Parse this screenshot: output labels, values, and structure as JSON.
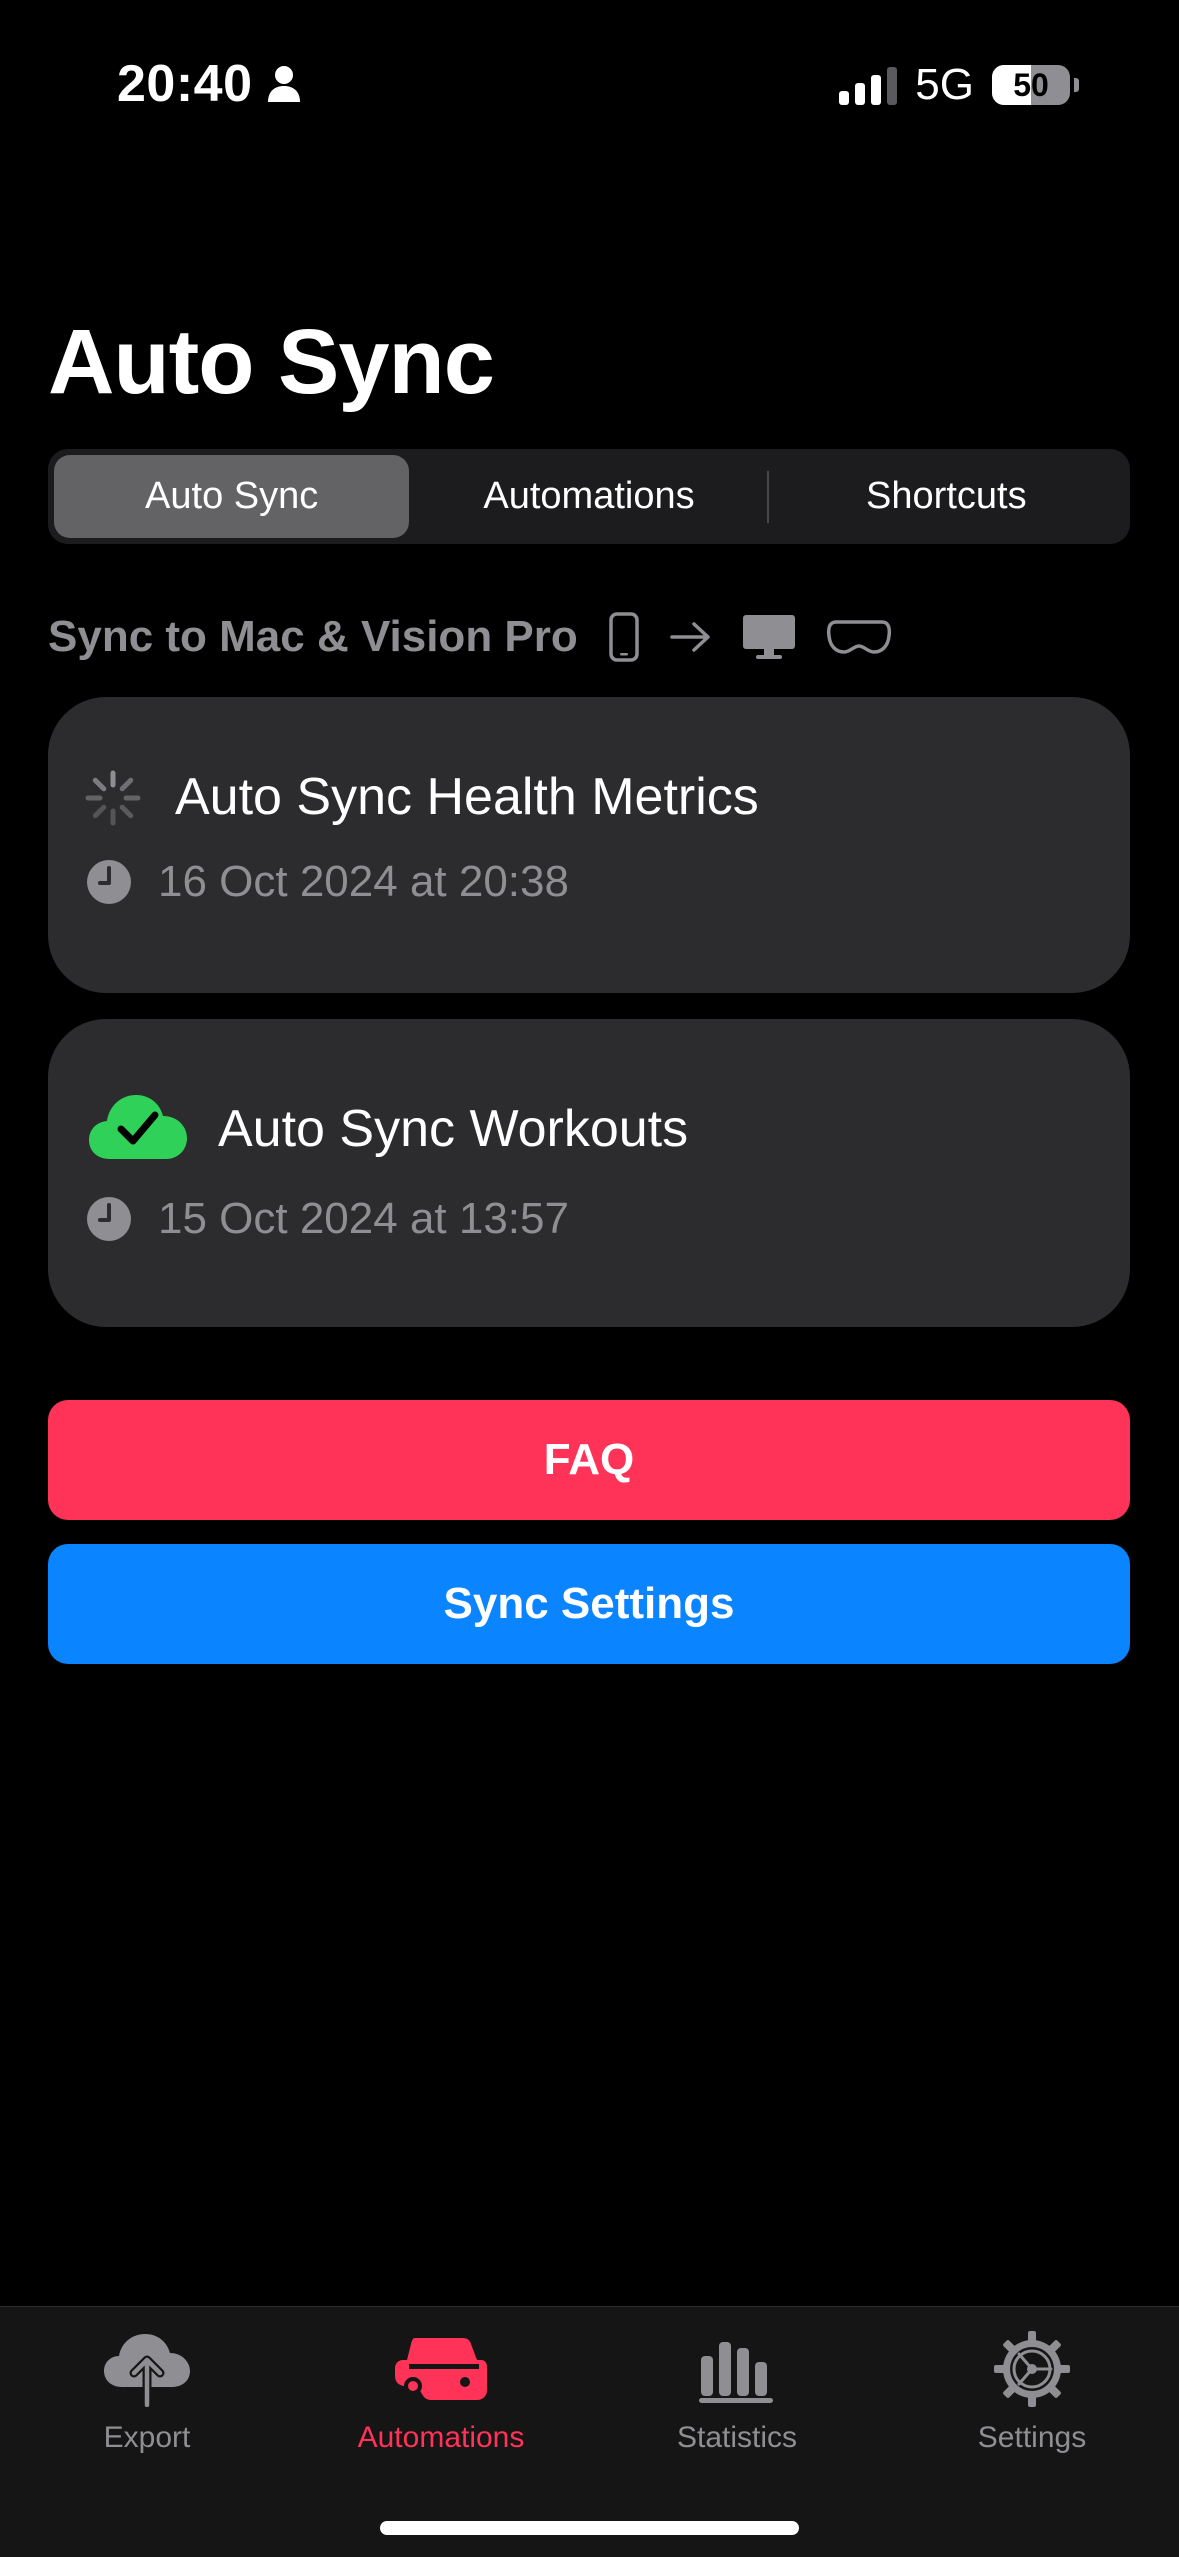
{
  "status_bar": {
    "time": "20:40",
    "network": "5G",
    "battery_level": "50",
    "battery_fraction": 0.5,
    "signal_bars_active": 3,
    "signal_bars_total": 4
  },
  "title": "Auto Sync",
  "segmented": {
    "items": [
      {
        "label": "Auto Sync",
        "active": true
      },
      {
        "label": "Automations",
        "active": false
      },
      {
        "label": "Shortcuts",
        "active": false
      }
    ]
  },
  "sync_header": {
    "label": "Sync to Mac & Vision Pro",
    "icons": [
      "iphone-icon",
      "arrow-right-icon",
      "mac-icon",
      "vision-pro-icon"
    ]
  },
  "cards": [
    {
      "title": "Auto Sync Health Metrics",
      "date": "16 Oct 2024 at 20:38",
      "status_icon": "spinner-icon"
    },
    {
      "title": "Auto Sync Workouts",
      "date": "15 Oct 2024 at 13:57",
      "status_icon": "cloud-check-icon"
    }
  ],
  "buttons": {
    "faq": "FAQ",
    "sync_settings": "Sync Settings"
  },
  "tab_bar": {
    "items": [
      {
        "label": "Export",
        "icon": "cloud-upload-icon",
        "active": false
      },
      {
        "label": "Automations",
        "icon": "automations-icon",
        "active": true
      },
      {
        "label": "Statistics",
        "icon": "bar-chart-icon",
        "active": false
      },
      {
        "label": "Settings",
        "icon": "gear-icon",
        "active": false
      }
    ]
  },
  "colors": {
    "accent_pink": "#ff3258",
    "accent_blue": "#0a84ff",
    "success_green": "#30d158",
    "card_bg": "#2c2c2e",
    "secondary_text": "#8e8e93"
  }
}
